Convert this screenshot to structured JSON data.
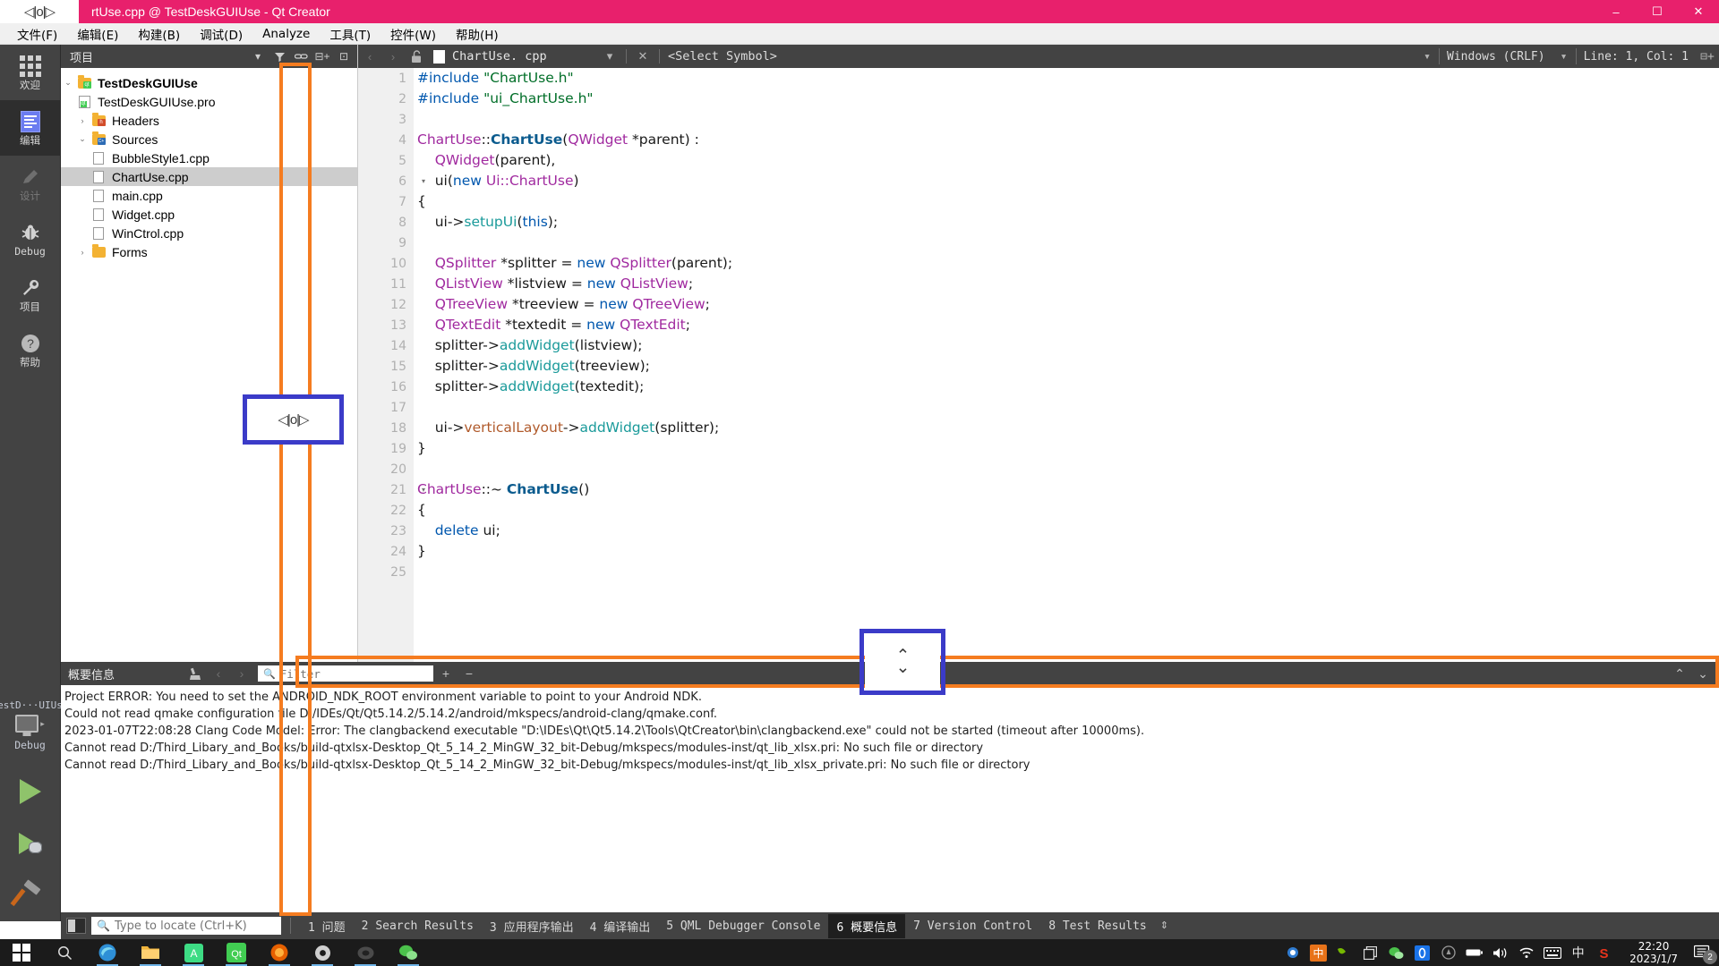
{
  "window": {
    "title": "rtUse.cpp @ TestDeskGUIUse - Qt Creator",
    "split_cursor_glyph": "◁|o|▷",
    "minimize": "–",
    "maximize": "☐",
    "close": "✕",
    "titlebar_color": "#e8206c"
  },
  "menubar": [
    {
      "label": "文件(F)",
      "key": "F"
    },
    {
      "label": "编辑(E)",
      "key": "E"
    },
    {
      "label": "构建(B)",
      "key": "B"
    },
    {
      "label": "调试(D)",
      "key": "D"
    },
    {
      "label": "Analyze",
      "key": "A"
    },
    {
      "label": "工具(T)",
      "key": "T"
    },
    {
      "label": "控件(W)",
      "key": "W"
    },
    {
      "label": "帮助(H)",
      "key": "H"
    }
  ],
  "modebar": {
    "items": [
      {
        "label": "欢迎",
        "icon": "grid-icon",
        "state": "normal"
      },
      {
        "label": "编辑",
        "icon": "edit-icon",
        "state": "active"
      },
      {
        "label": "设计",
        "icon": "pencil-icon",
        "state": "disabled"
      },
      {
        "label": "Debug",
        "icon": "bug-icon",
        "state": "normal"
      },
      {
        "label": "项目",
        "icon": "wrench-icon",
        "state": "normal"
      },
      {
        "label": "帮助",
        "icon": "question-icon",
        "state": "normal"
      }
    ],
    "kit": {
      "project": "TestD···UIUse",
      "build_config": "Debug",
      "arrow": "▸"
    },
    "actions": {
      "run": "run-button",
      "debug": "debug-button",
      "build": "build-button"
    }
  },
  "project_panel": {
    "header_title": "项目",
    "header_buttons": [
      "filter-icon",
      "link-icon",
      "split-icon",
      "close-panel-icon"
    ],
    "tree": [
      {
        "label": "TestDeskGUIUse",
        "indent": 0,
        "arrow": "⌄",
        "icon": "qt-folder",
        "bold": true,
        "selected": false
      },
      {
        "label": "TestDeskGUIUse.pro",
        "indent": 1,
        "arrow": "",
        "icon": "pro-file",
        "bold": false,
        "selected": false
      },
      {
        "label": "Headers",
        "indent": 1,
        "arrow": "›",
        "icon": "h-folder",
        "bold": false,
        "selected": false
      },
      {
        "label": "Sources",
        "indent": 1,
        "arrow": "⌄",
        "icon": "cpp-folder",
        "bold": false,
        "selected": false
      },
      {
        "label": "BubbleStyle1.cpp",
        "indent": 2,
        "arrow": "",
        "icon": "file",
        "bold": false,
        "selected": false
      },
      {
        "label": "ChartUse.cpp",
        "indent": 2,
        "arrow": "",
        "icon": "file",
        "bold": false,
        "selected": true
      },
      {
        "label": "main.cpp",
        "indent": 2,
        "arrow": "",
        "icon": "file",
        "bold": false,
        "selected": false
      },
      {
        "label": "Widget.cpp",
        "indent": 2,
        "arrow": "",
        "icon": "file",
        "bold": false,
        "selected": false
      },
      {
        "label": "WinCtrol.cpp",
        "indent": 2,
        "arrow": "",
        "icon": "file",
        "bold": false,
        "selected": false
      },
      {
        "label": "Forms",
        "indent": 1,
        "arrow": "›",
        "icon": "forms-folder",
        "bold": false,
        "selected": false
      }
    ]
  },
  "editor_toolbar": {
    "back": "‹",
    "forward": "›",
    "lock": "🔓",
    "filename": "ChartUse. cpp",
    "dropdown_caret": "▾",
    "close": "✕",
    "symbol_selector": "<Select Symbol>",
    "line_ending": "Windows (CRLF)",
    "line_ending_caret": "▾",
    "cursor_position": "Line: 1, Col: 1",
    "split_button": "⊟+"
  },
  "code": {
    "lines": [
      {
        "n": 1,
        "fold": "",
        "tokens": [
          {
            "t": "#include ",
            "c": "tk-pre"
          },
          {
            "t": "\"ChartUse.h\"",
            "c": "tk-str"
          }
        ]
      },
      {
        "n": 2,
        "fold": "",
        "tokens": [
          {
            "t": "#include ",
            "c": "tk-pre"
          },
          {
            "t": "\"ui_ChartUse.h\"",
            "c": "tk-str"
          }
        ]
      },
      {
        "n": 3,
        "fold": "",
        "tokens": []
      },
      {
        "n": 4,
        "fold": "",
        "tokens": [
          {
            "t": "ChartUse",
            "c": "tk-cls"
          },
          {
            "t": "::",
            "c": "tk-plain"
          },
          {
            "t": "ChartUse",
            "c": "tk-clsb"
          },
          {
            "t": "(",
            "c": "tk-plain"
          },
          {
            "t": "QWidget ",
            "c": "tk-cls"
          },
          {
            "t": "*parent) :",
            "c": "tk-plain"
          }
        ]
      },
      {
        "n": 5,
        "fold": "",
        "tokens": [
          {
            "t": "    ",
            "c": "tk-plain"
          },
          {
            "t": "QWidget",
            "c": "tk-cls"
          },
          {
            "t": "(parent),",
            "c": "tk-plain"
          }
        ]
      },
      {
        "n": 6,
        "fold": "▾",
        "tokens": [
          {
            "t": "    ui(",
            "c": "tk-plain"
          },
          {
            "t": "new ",
            "c": "tk-kw"
          },
          {
            "t": "Ui::ChartUse",
            "c": "tk-cls"
          },
          {
            "t": ")",
            "c": "tk-plain"
          }
        ]
      },
      {
        "n": 7,
        "fold": "",
        "tokens": [
          {
            "t": "{",
            "c": "tk-plain"
          }
        ]
      },
      {
        "n": 8,
        "fold": "",
        "tokens": [
          {
            "t": "    ui->",
            "c": "tk-plain"
          },
          {
            "t": "setupUi",
            "c": "tk-fn"
          },
          {
            "t": "(",
            "c": "tk-plain"
          },
          {
            "t": "this",
            "c": "tk-kw"
          },
          {
            "t": ");",
            "c": "tk-plain"
          }
        ]
      },
      {
        "n": 9,
        "fold": "",
        "tokens": []
      },
      {
        "n": 10,
        "fold": "",
        "tokens": [
          {
            "t": "    ",
            "c": "tk-plain"
          },
          {
            "t": "QSplitter ",
            "c": "tk-cls"
          },
          {
            "t": "*splitter = ",
            "c": "tk-plain"
          },
          {
            "t": "new ",
            "c": "tk-kw"
          },
          {
            "t": "QSplitter",
            "c": "tk-cls"
          },
          {
            "t": "(parent);",
            "c": "tk-plain"
          }
        ]
      },
      {
        "n": 11,
        "fold": "",
        "tokens": [
          {
            "t": "    ",
            "c": "tk-plain"
          },
          {
            "t": "QListView ",
            "c": "tk-cls"
          },
          {
            "t": "*listview = ",
            "c": "tk-plain"
          },
          {
            "t": "new ",
            "c": "tk-kw"
          },
          {
            "t": "QListView",
            "c": "tk-cls"
          },
          {
            "t": ";",
            "c": "tk-plain"
          }
        ]
      },
      {
        "n": 12,
        "fold": "",
        "tokens": [
          {
            "t": "    ",
            "c": "tk-plain"
          },
          {
            "t": "QTreeView ",
            "c": "tk-cls"
          },
          {
            "t": "*treeview = ",
            "c": "tk-plain"
          },
          {
            "t": "new ",
            "c": "tk-kw"
          },
          {
            "t": "QTreeView",
            "c": "tk-cls"
          },
          {
            "t": ";",
            "c": "tk-plain"
          }
        ]
      },
      {
        "n": 13,
        "fold": "",
        "tokens": [
          {
            "t": "    ",
            "c": "tk-plain"
          },
          {
            "t": "QTextEdit ",
            "c": "tk-cls"
          },
          {
            "t": "*textedit = ",
            "c": "tk-plain"
          },
          {
            "t": "new ",
            "c": "tk-kw"
          },
          {
            "t": "QTextEdit",
            "c": "tk-cls"
          },
          {
            "t": ";",
            "c": "tk-plain"
          }
        ]
      },
      {
        "n": 14,
        "fold": "",
        "tokens": [
          {
            "t": "    splitter->",
            "c": "tk-plain"
          },
          {
            "t": "addWidget",
            "c": "tk-fn"
          },
          {
            "t": "(listview);",
            "c": "tk-plain"
          }
        ]
      },
      {
        "n": 15,
        "fold": "",
        "tokens": [
          {
            "t": "    splitter->",
            "c": "tk-plain"
          },
          {
            "t": "addWidget",
            "c": "tk-fn"
          },
          {
            "t": "(treeview);",
            "c": "tk-plain"
          }
        ]
      },
      {
        "n": 16,
        "fold": "",
        "tokens": [
          {
            "t": "    splitter->",
            "c": "tk-plain"
          },
          {
            "t": "addWidget",
            "c": "tk-fn"
          },
          {
            "t": "(textedit);",
            "c": "tk-plain"
          }
        ]
      },
      {
        "n": 17,
        "fold": "",
        "tokens": []
      },
      {
        "n": 18,
        "fold": "",
        "tokens": [
          {
            "t": "    ui->",
            "c": "tk-plain"
          },
          {
            "t": "verticalLayout",
            "c": "tk-ui"
          },
          {
            "t": "->",
            "c": "tk-plain"
          },
          {
            "t": "addWidget",
            "c": "tk-fn"
          },
          {
            "t": "(splitter);",
            "c": "tk-plain"
          }
        ]
      },
      {
        "n": 19,
        "fold": "",
        "tokens": [
          {
            "t": "}",
            "c": "tk-plain"
          }
        ]
      },
      {
        "n": 20,
        "fold": "",
        "tokens": []
      },
      {
        "n": 21,
        "fold": "▾",
        "tokens": [
          {
            "t": "ChartUse",
            "c": "tk-cls"
          },
          {
            "t": "::~ ",
            "c": "tk-plain"
          },
          {
            "t": "ChartUse",
            "c": "tk-clsb"
          },
          {
            "t": "()",
            "c": "tk-plain"
          }
        ]
      },
      {
        "n": 22,
        "fold": "",
        "tokens": [
          {
            "t": "{",
            "c": "tk-plain"
          }
        ]
      },
      {
        "n": 23,
        "fold": "",
        "tokens": [
          {
            "t": "    ",
            "c": "tk-plain"
          },
          {
            "t": "delete ",
            "c": "tk-kw"
          },
          {
            "t": "ui;",
            "c": "tk-plain"
          }
        ]
      },
      {
        "n": 24,
        "fold": "",
        "tokens": [
          {
            "t": "}",
            "c": "tk-plain"
          }
        ]
      },
      {
        "n": 25,
        "fold": "",
        "tokens": []
      }
    ]
  },
  "output_pane": {
    "title": "概要信息",
    "clear_icon": "broom-icon",
    "prev_icon": "‹",
    "next_icon": "›",
    "filter_placeholder": "Filter",
    "filter_value": "",
    "zoom_in": "+",
    "zoom_out": "−",
    "maximize": "⌃",
    "close": "⌄",
    "lines": [
      "Project ERROR: You need to set the ANDROID_NDK_ROOT environment variable to point to your Android NDK.",
      "Could not read qmake configuration file D:/IDEs/Qt/Qt5.14.2/5.14.2/android/mkspecs/android-clang/qmake.conf.",
      "2023-01-07T22:08:28 Clang Code Model: Error: The clangbackend executable \"D:\\IDEs\\Qt\\Qt5.14.2\\Tools\\QtCreator\\bin\\clangbackend.exe\" could not be started (timeout after 10000ms).",
      "Cannot read D:/Third_Libary_and_Books/build-qtxlsx-Desktop_Qt_5_14_2_MinGW_32_bit-Debug/mkspecs/modules-inst/qt_lib_xlsx.pri: No such file or directory",
      "Cannot read D:/Third_Libary_and_Books/build-qtxlsx-Desktop_Qt_5_14_2_MinGW_32_bit-Debug/mkspecs/modules-inst/qt_lib_xlsx_private.pri: No such file or directory"
    ]
  },
  "statusbar": {
    "sidebar_toggle": "sidebar-toggle-icon",
    "locator_placeholder": "Type to locate (Ctrl+K)",
    "locator_value": "",
    "tabs": [
      {
        "num": "1",
        "label": "问题",
        "active": false
      },
      {
        "num": "2",
        "label": "Search Results",
        "active": false
      },
      {
        "num": "3",
        "label": "应用程序输出",
        "active": false
      },
      {
        "num": "4",
        "label": "编译输出",
        "active": false
      },
      {
        "num": "5",
        "label": "QML Debugger Console",
        "active": false
      },
      {
        "num": "6",
        "label": "概要信息",
        "active": true
      },
      {
        "num": "7",
        "label": "Version Control",
        "active": false
      },
      {
        "num": "8",
        "label": "Test Results",
        "active": false
      }
    ],
    "stepper": "⇕"
  },
  "taskbar": {
    "start": "windows-logo",
    "items": [
      {
        "name": "search-icon",
        "glyph": "🔍",
        "color": "#d8d8d8",
        "running": false
      },
      {
        "name": "edge-icon",
        "glyph": "",
        "color": "#3eb6e8",
        "running": true
      },
      {
        "name": "file-explorer-icon",
        "glyph": "",
        "color": "#f0b43c",
        "running": true
      },
      {
        "name": "android-studio-icon",
        "glyph": "A",
        "color": "#3ddc84",
        "running": true
      },
      {
        "name": "qt-creator-icon",
        "glyph": "Qt",
        "color": "#41cd52",
        "running": true
      },
      {
        "name": "firefox-icon",
        "glyph": "",
        "color": "#e66000",
        "running": true
      },
      {
        "name": "settings-icon",
        "glyph": "⚙",
        "color": "#cfcfcf",
        "running": true
      },
      {
        "name": "vlc-icon",
        "glyph": "",
        "color": "#444444",
        "running": true
      },
      {
        "name": "wechat-icon",
        "glyph": "",
        "color": "#4bc14b",
        "running": true
      }
    ],
    "tray": [
      {
        "name": "sogou-pinyin-icon",
        "glyph": "◎",
        "color": "#2f7bd0"
      },
      {
        "name": "ime-chinese-icon",
        "glyph": "中",
        "color": "#ffffff",
        "bg": "#e8731a"
      },
      {
        "name": "nvidia-icon",
        "glyph": "◉",
        "color": "#76b900"
      },
      {
        "name": "copy-icon",
        "glyph": "⧉",
        "color": "#dddddd"
      },
      {
        "name": "wechat-tray-icon",
        "glyph": "◍",
        "color": "#4bc14b"
      },
      {
        "name": "opera-icon",
        "glyph": "O",
        "color": "#1a73e8",
        "bg": "#1a73e8"
      },
      {
        "name": "shield-icon",
        "glyph": "⊛",
        "color": "#9a9a9a"
      },
      {
        "name": "battery-icon",
        "glyph": "▭",
        "color": "#ffffff"
      },
      {
        "name": "volume-icon",
        "glyph": "◀))",
        "color": "#ffffff"
      },
      {
        "name": "wifi-icon",
        "glyph": "⌒",
        "color": "#ffffff"
      },
      {
        "name": "keyboard-icon",
        "glyph": "⌨",
        "color": "#ffffff"
      },
      {
        "name": "ime-mode-icon",
        "glyph": "中",
        "color": "#ffffff"
      },
      {
        "name": "sogou-s-icon",
        "glyph": "S",
        "color": "#e8341c"
      }
    ],
    "clock_time": "22:20",
    "clock_date": "2023/1/7",
    "notification_icon": "notification-icon",
    "notification_count": "2"
  },
  "annotations": {
    "orange_color": "#f57c20",
    "blue_color": "#3b3bc8",
    "split_cursor_glyph": "◁|o|▷",
    "updown_cursor_glyph": "⇕"
  }
}
